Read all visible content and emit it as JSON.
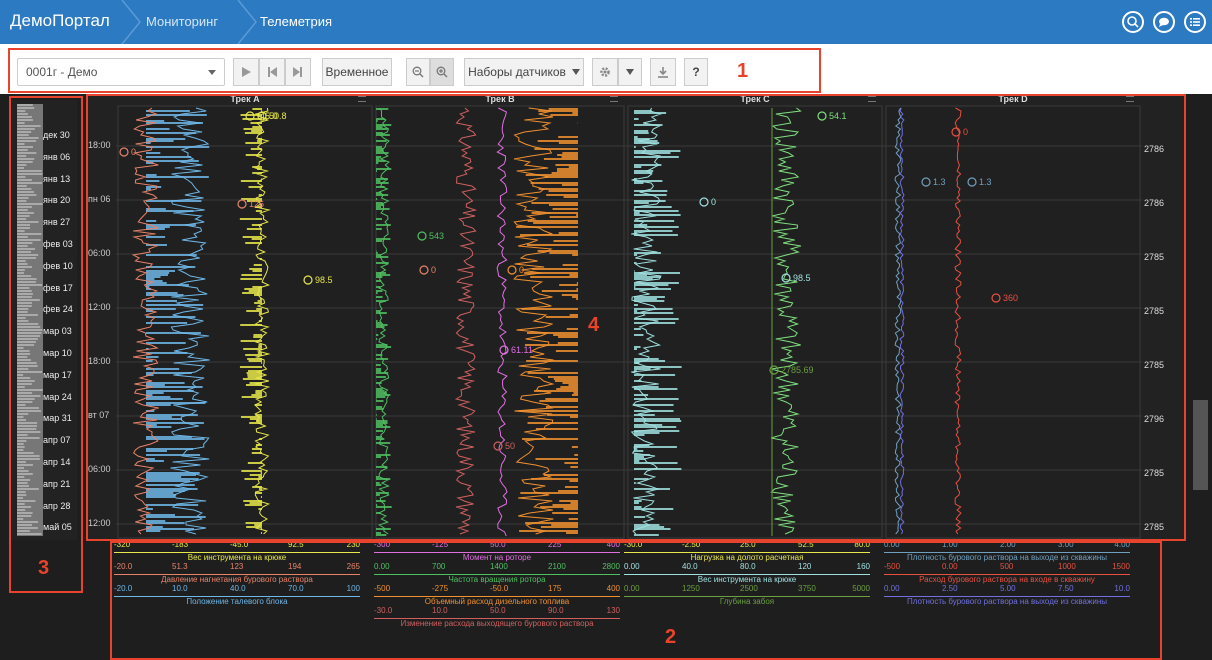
{
  "topbar": {
    "brand": "ДемоПортал",
    "breadcrumbs": [
      "Мониторинг",
      "Телеметрия"
    ],
    "icons": [
      "search-icon",
      "chat-icon",
      "menu-list-icon"
    ]
  },
  "toolbar": {
    "well_select": "0001г - Демо",
    "time_button": "Временное",
    "sensor_sets": "Наборы датчиков",
    "help": "?"
  },
  "annotations": [
    "1",
    "2",
    "3",
    "4"
  ],
  "side_dates": [
    "дек 30",
    "янв 06",
    "янв 13",
    "янв 20",
    "янв 27",
    "фев 03",
    "фев 10",
    "фев 17",
    "фев 24",
    "мар 03",
    "мар 10",
    "мар 17",
    "мар 24",
    "мар 31",
    "апр 07",
    "апр 14",
    "апр 21",
    "апр 28",
    "май 05"
  ],
  "time_labels": [
    "18:00",
    "пн 06",
    "06:00",
    "12:00",
    "18:00",
    "вт 07",
    "06:00",
    "12:00"
  ],
  "depth_labels": [
    "2786",
    "2786",
    "2785",
    "2785",
    "2785",
    "2796",
    "2785",
    "2785"
  ],
  "tracks": [
    {
      "title": "Трек A",
      "markers": [
        "50.8",
        "-45.0",
        "0",
        "126",
        "98.5"
      ],
      "legend": [
        {
          "ticks": [
            "-320",
            "-183",
            "-45.0",
            "92.5",
            "230"
          ],
          "name": "Вес инструмента на крюке",
          "color": "#e8e84a"
        },
        {
          "ticks": [
            "-20.0",
            "51.3",
            "123",
            "194",
            "265"
          ],
          "name": "Давление нагнетания бурового раствора",
          "color": "#e8836a"
        },
        {
          "ticks": [
            "-20.0",
            "10.0",
            "40.0",
            "70.0",
            "100"
          ],
          "name": "Положение талевого блока",
          "color": "#6fb7e8"
        }
      ]
    },
    {
      "title": "Трек B",
      "markers": [
        "543",
        "0",
        "0",
        "61.11",
        "50"
      ],
      "legend": [
        {
          "ticks": [
            "-300",
            "-125",
            "50.0",
            "225",
            "400"
          ],
          "name": "Момент на роторе",
          "color": "#e070e0"
        },
        {
          "ticks": [
            "0.00",
            "700",
            "1400",
            "2100",
            "2800"
          ],
          "name": "Частота вращения ротора",
          "color": "#4fc062"
        },
        {
          "ticks": [
            "-500",
            "-275",
            "-50.0",
            "175",
            "400"
          ],
          "name": "Объемный расход дизельного топлива",
          "color": "#f09030"
        },
        {
          "ticks": [
            "-30.0",
            "10.0",
            "50.0",
            "90.0",
            "130"
          ],
          "name": "Изменение расхода выходящего бурового раствора",
          "color": "#d06060"
        }
      ]
    },
    {
      "title": "Трек C",
      "markers": [
        "54.1",
        "0",
        "98.5",
        "2785.69"
      ],
      "legend": [
        {
          "ticks": [
            "-30.0",
            "-2.50",
            "25.0",
            "52.5",
            "80.0"
          ],
          "name": "Нагрузка на долото расчетная",
          "color": "#e8e84a"
        },
        {
          "ticks": [
            "0.00",
            "40.0",
            "80.0",
            "120",
            "160"
          ],
          "name": "Вес инструмента на крюке",
          "color": "#a0e0e0"
        },
        {
          "ticks": [
            "0.00",
            "1250",
            "2500",
            "3750",
            "5000"
          ],
          "name": "Глубина забоя",
          "color": "#6aa040"
        }
      ]
    },
    {
      "title": "Трек D",
      "markers": [
        "0",
        "1.3",
        "1.3",
        "360"
      ],
      "legend": [
        {
          "ticks": [
            "0.00",
            "1.00",
            "2.00",
            "3.00",
            "4.00"
          ],
          "name": "Плотность бурового раствора на выходе из скважины",
          "color": "#70a0c0"
        },
        {
          "ticks": [
            "-500",
            "0.00",
            "500",
            "1000",
            "1500"
          ],
          "name": "Расход бурового раствора на входе в скважину",
          "color": "#e85040"
        },
        {
          "ticks": [
            "0.00",
            "2.50",
            "5.00",
            "7.50",
            "10.0"
          ],
          "name": "Плотность бурового раствора на выходе из скважины",
          "color": "#7070e0"
        }
      ]
    }
  ]
}
